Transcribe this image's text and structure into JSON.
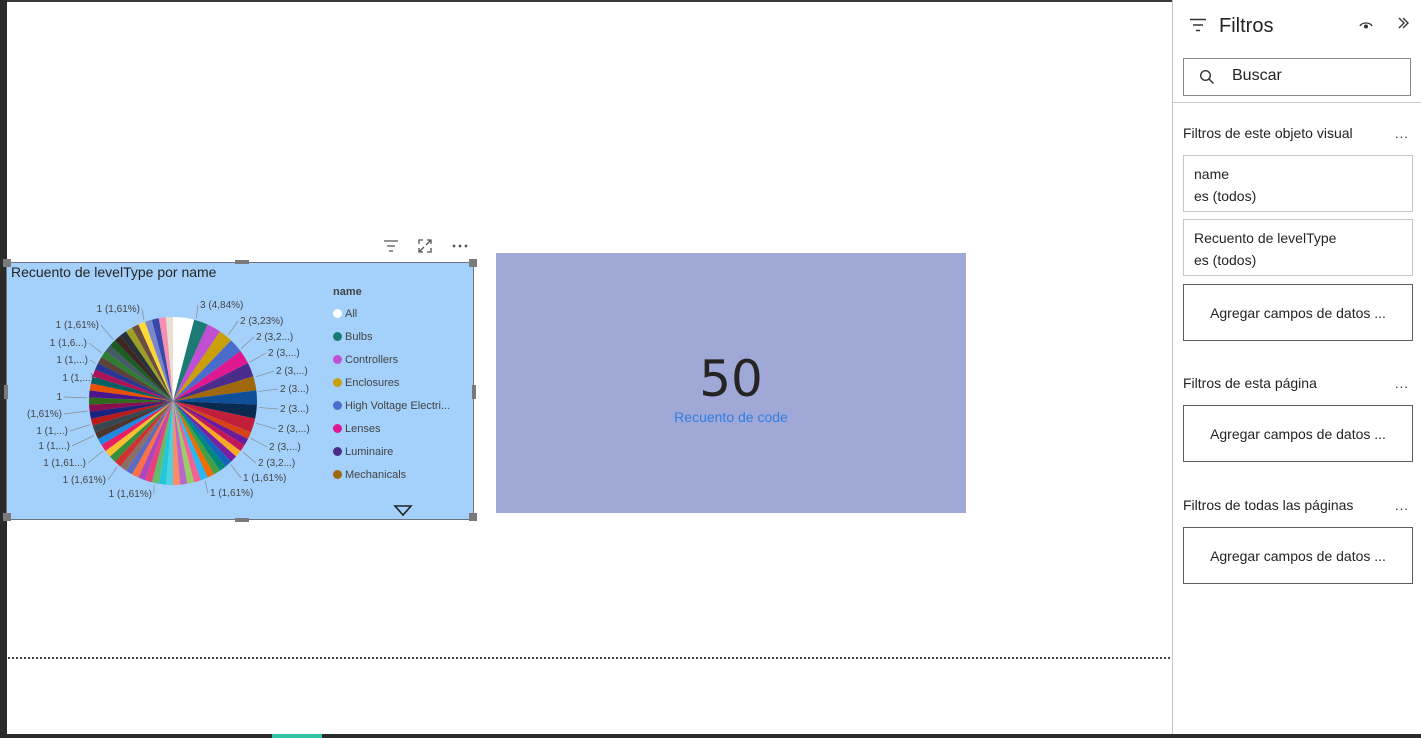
{
  "pie_visual": {
    "title": "Recuento de levelType por name",
    "legend_title": "name",
    "legend": [
      {
        "label": "All",
        "color": "#ffffff"
      },
      {
        "label": "Bulbs",
        "color": "#1b7a73"
      },
      {
        "label": "Controllers",
        "color": "#c14fd1"
      },
      {
        "label": "Enclosures",
        "color": "#c9a00a"
      },
      {
        "label": "High Voltage Electri...",
        "color": "#4a6ccc"
      },
      {
        "label": "Lenses",
        "color": "#e0188f"
      },
      {
        "label": "Luminaire",
        "color": "#4b2c8a"
      },
      {
        "label": "Mechanicals",
        "color": "#a0680d"
      }
    ],
    "data_labels": {
      "right": [
        "3 (4,84%)",
        "2 (3,23%)",
        "2 (3,2...)",
        "2 (3,...)",
        "2 (3,...)",
        "2 (3...)",
        "2 (3...)",
        "2 (3,...)",
        "2 (3,...)",
        "2 (3,2...)",
        "1 (1,61%)",
        "1 (1,61%)"
      ],
      "left": [
        "1 (1,61%)",
        "1 (1,61%)",
        "1 (1,6...)",
        "1 (1,...)",
        "1 (1,...)",
        "1",
        "(1,61%)",
        "1 (1,...)",
        "1 (1,...)",
        "1 (1,61...)",
        "1 (1,61%)",
        "1 (1,61%)"
      ]
    }
  },
  "chart_data": {
    "type": "pie",
    "title": "Recuento de levelType por name",
    "legend_title": "name",
    "legend_placement": "right",
    "slices": [
      {
        "label": "All",
        "value": 3,
        "pct": "4,84%",
        "color": "#ffffff"
      },
      {
        "label": "Bulbs",
        "value": 2,
        "pct": "3,23%",
        "color": "#1b7a73"
      },
      {
        "label": "Controllers",
        "value": 2,
        "pct": "3,23%",
        "color": "#c14fd1"
      },
      {
        "label": "Enclosures",
        "value": 2,
        "pct": "3,23%",
        "color": "#c9a00a"
      },
      {
        "label": "High Voltage Electri...",
        "value": 2,
        "pct": "3,23%",
        "color": "#4a6ccc"
      },
      {
        "label": "Lenses",
        "value": 2,
        "pct": "3,23%",
        "color": "#e0188f"
      },
      {
        "label": "Luminaire",
        "value": 2,
        "pct": "3,23%",
        "color": "#4b2c8a"
      },
      {
        "label": "Mechanicals",
        "value": 2,
        "pct": "3,23%",
        "color": "#a0680d"
      },
      {
        "value": 2,
        "color": "#0f4f9a"
      },
      {
        "value": 2,
        "color": "#0b2a52"
      },
      {
        "value": 2,
        "color": "#c21f3a"
      },
      {
        "value": 1,
        "color": "#d84315"
      },
      {
        "value": 1,
        "color": "#6a1b9a"
      },
      {
        "value": 1,
        "color": "#c2185b"
      },
      {
        "value": 1,
        "color": "#f9a825"
      },
      {
        "value": 1,
        "color": "#7b1fa2"
      },
      {
        "value": 1,
        "color": "#1565c0"
      },
      {
        "value": 1,
        "color": "#00897b"
      },
      {
        "value": 1,
        "color": "#43a047"
      },
      {
        "value": 1,
        "color": "#ef6c00"
      },
      {
        "value": 1,
        "color": "#29b6f6"
      },
      {
        "value": 1,
        "color": "#f06292"
      },
      {
        "value": 1,
        "color": "#9ccc65"
      },
      {
        "value": 1,
        "color": "#ba68c8"
      },
      {
        "value": 1,
        "color": "#ff8a65"
      },
      {
        "value": 1,
        "color": "#4dd0e1"
      },
      {
        "value": 1,
        "color": "#26c6da"
      },
      {
        "value": 1,
        "color": "#66bb6a"
      },
      {
        "value": 1,
        "color": "#ec407a"
      },
      {
        "value": 1,
        "color": "#ab47bc"
      },
      {
        "value": 1,
        "color": "#ff7043"
      },
      {
        "value": 1,
        "color": "#5c6bc0"
      },
      {
        "value": 1,
        "color": "#8d6e63"
      },
      {
        "value": 1,
        "color": "#d32f2f"
      },
      {
        "value": 1,
        "color": "#388e3c"
      },
      {
        "value": 1,
        "color": "#fbc02d"
      },
      {
        "value": 1,
        "color": "#e91e63"
      },
      {
        "value": 1,
        "color": "#1e88e5"
      },
      {
        "value": 1,
        "color": "#4e342e"
      },
      {
        "value": 1,
        "color": "#37474f"
      },
      {
        "value": 1,
        "color": "#b71c1c"
      },
      {
        "value": 1,
        "color": "#1a237e"
      },
      {
        "value": 1,
        "color": "#880e4f"
      },
      {
        "value": 1,
        "color": "#33691e"
      },
      {
        "value": 1,
        "color": "#4a148c"
      },
      {
        "value": 1,
        "color": "#e65100"
      },
      {
        "value": 1,
        "color": "#006064"
      },
      {
        "value": 1,
        "color": "#ad1457"
      },
      {
        "value": 1,
        "color": "#283593"
      },
      {
        "value": 1,
        "color": "#5d4037"
      },
      {
        "value": 1,
        "color": "#2e7d32"
      },
      {
        "value": 1,
        "color": "#455a64"
      },
      {
        "value": 1,
        "color": "#1b5e20"
      },
      {
        "value": 1,
        "color": "#3e2723"
      },
      {
        "value": 1,
        "color": "#263238"
      },
      {
        "value": 1,
        "color": "#9e9d24"
      },
      {
        "value": 1,
        "color": "#6d4c41"
      },
      {
        "value": 1,
        "color": "#fdd835"
      },
      {
        "value": 1,
        "color": "#7986cb"
      },
      {
        "value": 1,
        "color": "#3949ab"
      },
      {
        "value": 1,
        "color": "#f48fb1"
      },
      {
        "value": 1,
        "color": "#e8dfd0"
      }
    ]
  },
  "card": {
    "value": "50",
    "label": "Recuento de code"
  },
  "filter_pane": {
    "title": "Filtros",
    "search_placeholder": "Buscar",
    "visual_section": {
      "title": "Filtros de este objeto visual",
      "more": "...",
      "filters": [
        {
          "field": "name",
          "condition": "es (todos)"
        },
        {
          "field": "Recuento de levelType",
          "condition": "es (todos)"
        }
      ],
      "add_label": "Agregar campos de datos ..."
    },
    "page_section": {
      "title": "Filtros de esta página",
      "more": "...",
      "add_label": "Agregar campos de datos ..."
    },
    "all_pages_section": {
      "title": "Filtros de todas las páginas",
      "more": "...",
      "add_label": "Agregar campos de datos ..."
    }
  }
}
